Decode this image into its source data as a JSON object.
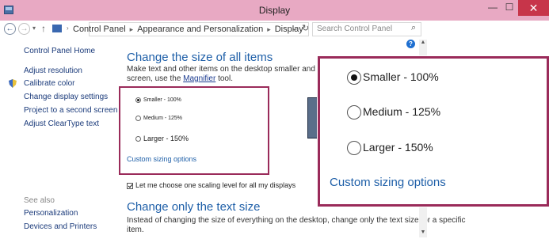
{
  "window": {
    "title": "Display",
    "minimize": "—",
    "maximize": "☐",
    "close": "✕"
  },
  "address": {
    "crumbs": [
      "Control Panel",
      "Appearance and Personalization",
      "Display"
    ],
    "search_placeholder": "Search Control Panel"
  },
  "sidebar": {
    "items": [
      {
        "label": "Control Panel Home"
      },
      {
        "label": "Adjust resolution"
      },
      {
        "label": "Calibrate color"
      },
      {
        "label": "Change display settings"
      },
      {
        "label": "Project to a second screen"
      },
      {
        "label": "Adjust ClearType text"
      }
    ],
    "see_also": "See also",
    "see_also_items": [
      {
        "label": "Personalization"
      },
      {
        "label": "Devices and Printers"
      }
    ]
  },
  "main": {
    "heading1": "Change the size of all items",
    "desc1_a": "Make text and other items on the desktop smaller and larger. To ter",
    "desc1_b": "screen, use the",
    "magnifier_link": "Magnifier",
    "desc1_c": "tool.",
    "options": [
      {
        "label": "Smaller - 100%",
        "selected": true
      },
      {
        "label": "Medium - 125%",
        "selected": false
      },
      {
        "label": "Larger - 150%",
        "selected": false
      }
    ],
    "custom_link": "Custom sizing options",
    "checkbox_label": "Let me choose one scaling level for all my displays",
    "checkbox_checked": true,
    "heading2": "Change only the text size",
    "desc2_a": "Instead of changing the size of everything on the desktop, change only the text size for a specific",
    "desc2_b": "item."
  },
  "colors": {
    "titlebar": "#e8a9c3",
    "accent": "#9a2b5a",
    "link": "#1e5fa8",
    "close": "#c7354a"
  }
}
